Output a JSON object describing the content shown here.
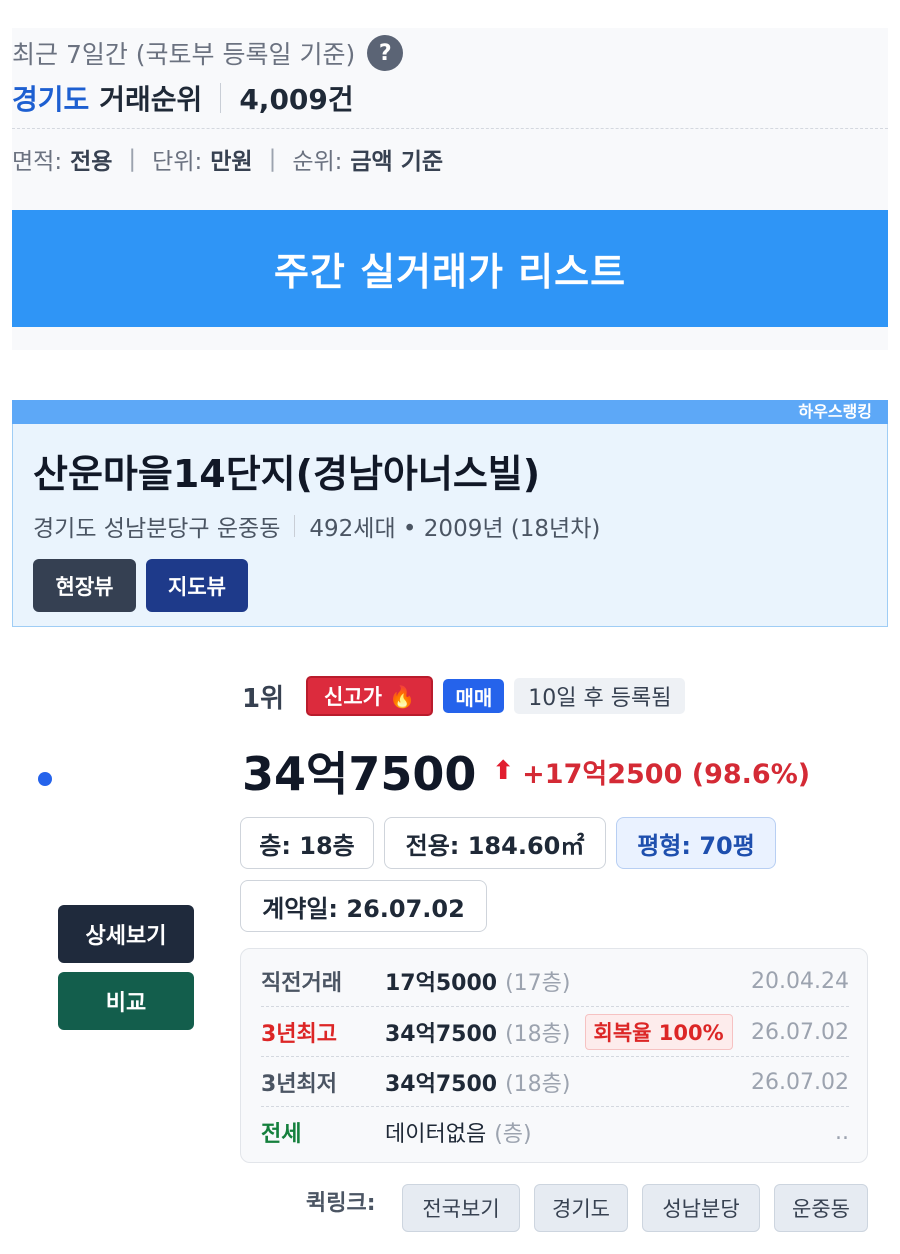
{
  "summary": {
    "period_text": "최근 7일간 (국토부 등록일 기준)",
    "help_icon": "question-icon",
    "region": "경기도",
    "rank_label": "거래순위",
    "count": "4,009건",
    "filters": [
      {
        "key": "면적:",
        "value": "전용"
      },
      {
        "key": "단위:",
        "value": "만원"
      },
      {
        "key": "순위:",
        "value": "금액 기준"
      }
    ],
    "filter_sep": "|",
    "weekly_button": "주간 실거래가 리스트"
  },
  "apartment": {
    "brand": "하우스랭킹",
    "name": "산운마을14단지(경남아너스빌)",
    "address": "경기도 성남분당구 운중동",
    "meta": "492세대 • 2009년 (18년차)",
    "site_view": "현장뷰",
    "map_view": "지도뷰"
  },
  "listing": {
    "rank": "1위",
    "badge_high": "신고가 🔥",
    "badge_sale": "매매",
    "registered": "10일 후 등록됨",
    "price": "34억7500",
    "arrow": "⬆",
    "change": "+17억2500 (98.6%)",
    "floor": "층: 18층",
    "area": "전용: 184.60㎡",
    "pyeong": "평형: 70평",
    "contract_date": "계약일: 26.07.02",
    "detail_button": "상세보기",
    "compare_button": "비교"
  },
  "history": [
    {
      "label": "직전거래",
      "price": "17억5000",
      "floor": "(17층)",
      "recovery": "",
      "date": "20.04.24",
      "style": "gray"
    },
    {
      "label": "3년최고",
      "price": "34억7500",
      "floor": "(18층)",
      "recovery": "회복율 100%",
      "date": "26.07.02",
      "style": "red"
    },
    {
      "label": "3년최저",
      "price": "34억7500",
      "floor": "(18층)",
      "recovery": "",
      "date": "26.07.02",
      "style": "gray"
    },
    {
      "label": "전세",
      "price": "데이터없음",
      "floor": "(층)",
      "recovery": "",
      "date": "..",
      "style": "green"
    }
  ],
  "quicklinks": {
    "label": "퀵링크:",
    "items": [
      "전국보기",
      "경기도",
      "성남분당",
      "운중동"
    ]
  },
  "colors": {
    "accent_blue": "#2f95f6",
    "region_blue": "#1d5fd1",
    "price_up_red": "#d42a35",
    "jeonse_green": "#15803d"
  }
}
